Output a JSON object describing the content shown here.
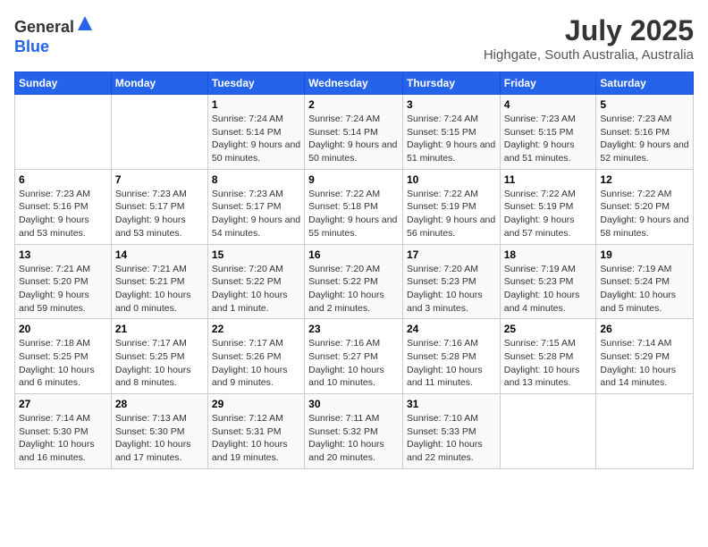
{
  "header": {
    "logo_line1": "General",
    "logo_line2": "Blue",
    "title": "July 2025",
    "subtitle": "Highgate, South Australia, Australia"
  },
  "weekdays": [
    "Sunday",
    "Monday",
    "Tuesday",
    "Wednesday",
    "Thursday",
    "Friday",
    "Saturday"
  ],
  "weeks": [
    [
      {
        "day": "",
        "sunrise": "",
        "sunset": "",
        "daylight": ""
      },
      {
        "day": "",
        "sunrise": "",
        "sunset": "",
        "daylight": ""
      },
      {
        "day": "1",
        "sunrise": "Sunrise: 7:24 AM",
        "sunset": "Sunset: 5:14 PM",
        "daylight": "Daylight: 9 hours and 50 minutes."
      },
      {
        "day": "2",
        "sunrise": "Sunrise: 7:24 AM",
        "sunset": "Sunset: 5:14 PM",
        "daylight": "Daylight: 9 hours and 50 minutes."
      },
      {
        "day": "3",
        "sunrise": "Sunrise: 7:24 AM",
        "sunset": "Sunset: 5:15 PM",
        "daylight": "Daylight: 9 hours and 51 minutes."
      },
      {
        "day": "4",
        "sunrise": "Sunrise: 7:23 AM",
        "sunset": "Sunset: 5:15 PM",
        "daylight": "Daylight: 9 hours and 51 minutes."
      },
      {
        "day": "5",
        "sunrise": "Sunrise: 7:23 AM",
        "sunset": "Sunset: 5:16 PM",
        "daylight": "Daylight: 9 hours and 52 minutes."
      }
    ],
    [
      {
        "day": "6",
        "sunrise": "Sunrise: 7:23 AM",
        "sunset": "Sunset: 5:16 PM",
        "daylight": "Daylight: 9 hours and 53 minutes."
      },
      {
        "day": "7",
        "sunrise": "Sunrise: 7:23 AM",
        "sunset": "Sunset: 5:17 PM",
        "daylight": "Daylight: 9 hours and 53 minutes."
      },
      {
        "day": "8",
        "sunrise": "Sunrise: 7:23 AM",
        "sunset": "Sunset: 5:17 PM",
        "daylight": "Daylight: 9 hours and 54 minutes."
      },
      {
        "day": "9",
        "sunrise": "Sunrise: 7:22 AM",
        "sunset": "Sunset: 5:18 PM",
        "daylight": "Daylight: 9 hours and 55 minutes."
      },
      {
        "day": "10",
        "sunrise": "Sunrise: 7:22 AM",
        "sunset": "Sunset: 5:19 PM",
        "daylight": "Daylight: 9 hours and 56 minutes."
      },
      {
        "day": "11",
        "sunrise": "Sunrise: 7:22 AM",
        "sunset": "Sunset: 5:19 PM",
        "daylight": "Daylight: 9 hours and 57 minutes."
      },
      {
        "day": "12",
        "sunrise": "Sunrise: 7:22 AM",
        "sunset": "Sunset: 5:20 PM",
        "daylight": "Daylight: 9 hours and 58 minutes."
      }
    ],
    [
      {
        "day": "13",
        "sunrise": "Sunrise: 7:21 AM",
        "sunset": "Sunset: 5:20 PM",
        "daylight": "Daylight: 9 hours and 59 minutes."
      },
      {
        "day": "14",
        "sunrise": "Sunrise: 7:21 AM",
        "sunset": "Sunset: 5:21 PM",
        "daylight": "Daylight: 10 hours and 0 minutes."
      },
      {
        "day": "15",
        "sunrise": "Sunrise: 7:20 AM",
        "sunset": "Sunset: 5:22 PM",
        "daylight": "Daylight: 10 hours and 1 minute."
      },
      {
        "day": "16",
        "sunrise": "Sunrise: 7:20 AM",
        "sunset": "Sunset: 5:22 PM",
        "daylight": "Daylight: 10 hours and 2 minutes."
      },
      {
        "day": "17",
        "sunrise": "Sunrise: 7:20 AM",
        "sunset": "Sunset: 5:23 PM",
        "daylight": "Daylight: 10 hours and 3 minutes."
      },
      {
        "day": "18",
        "sunrise": "Sunrise: 7:19 AM",
        "sunset": "Sunset: 5:23 PM",
        "daylight": "Daylight: 10 hours and 4 minutes."
      },
      {
        "day": "19",
        "sunrise": "Sunrise: 7:19 AM",
        "sunset": "Sunset: 5:24 PM",
        "daylight": "Daylight: 10 hours and 5 minutes."
      }
    ],
    [
      {
        "day": "20",
        "sunrise": "Sunrise: 7:18 AM",
        "sunset": "Sunset: 5:25 PM",
        "daylight": "Daylight: 10 hours and 6 minutes."
      },
      {
        "day": "21",
        "sunrise": "Sunrise: 7:17 AM",
        "sunset": "Sunset: 5:25 PM",
        "daylight": "Daylight: 10 hours and 8 minutes."
      },
      {
        "day": "22",
        "sunrise": "Sunrise: 7:17 AM",
        "sunset": "Sunset: 5:26 PM",
        "daylight": "Daylight: 10 hours and 9 minutes."
      },
      {
        "day": "23",
        "sunrise": "Sunrise: 7:16 AM",
        "sunset": "Sunset: 5:27 PM",
        "daylight": "Daylight: 10 hours and 10 minutes."
      },
      {
        "day": "24",
        "sunrise": "Sunrise: 7:16 AM",
        "sunset": "Sunset: 5:28 PM",
        "daylight": "Daylight: 10 hours and 11 minutes."
      },
      {
        "day": "25",
        "sunrise": "Sunrise: 7:15 AM",
        "sunset": "Sunset: 5:28 PM",
        "daylight": "Daylight: 10 hours and 13 minutes."
      },
      {
        "day": "26",
        "sunrise": "Sunrise: 7:14 AM",
        "sunset": "Sunset: 5:29 PM",
        "daylight": "Daylight: 10 hours and 14 minutes."
      }
    ],
    [
      {
        "day": "27",
        "sunrise": "Sunrise: 7:14 AM",
        "sunset": "Sunset: 5:30 PM",
        "daylight": "Daylight: 10 hours and 16 minutes."
      },
      {
        "day": "28",
        "sunrise": "Sunrise: 7:13 AM",
        "sunset": "Sunset: 5:30 PM",
        "daylight": "Daylight: 10 hours and 17 minutes."
      },
      {
        "day": "29",
        "sunrise": "Sunrise: 7:12 AM",
        "sunset": "Sunset: 5:31 PM",
        "daylight": "Daylight: 10 hours and 19 minutes."
      },
      {
        "day": "30",
        "sunrise": "Sunrise: 7:11 AM",
        "sunset": "Sunset: 5:32 PM",
        "daylight": "Daylight: 10 hours and 20 minutes."
      },
      {
        "day": "31",
        "sunrise": "Sunrise: 7:10 AM",
        "sunset": "Sunset: 5:33 PM",
        "daylight": "Daylight: 10 hours and 22 minutes."
      },
      {
        "day": "",
        "sunrise": "",
        "sunset": "",
        "daylight": ""
      },
      {
        "day": "",
        "sunrise": "",
        "sunset": "",
        "daylight": ""
      }
    ]
  ]
}
